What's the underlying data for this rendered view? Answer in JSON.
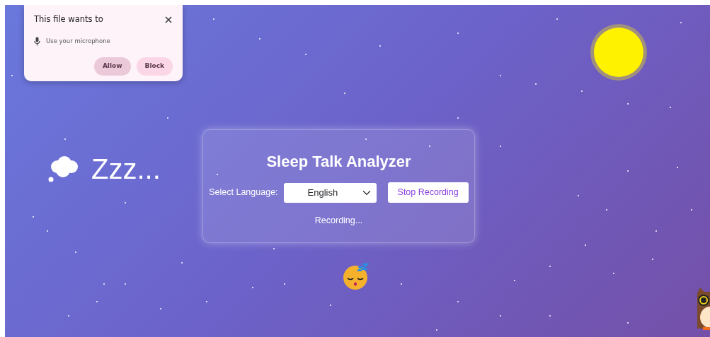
{
  "permission_popup": {
    "title": "This file wants to",
    "permission": "Use your microphone",
    "buttons": [
      "Allow",
      "Block"
    ]
  },
  "sleep_text": "Zzz...",
  "app": {
    "title": "Sleep Talk Analyzer",
    "language_label": "Select Language:",
    "language_value": "English",
    "button": "Stop Recording",
    "status": "Recording..."
  }
}
